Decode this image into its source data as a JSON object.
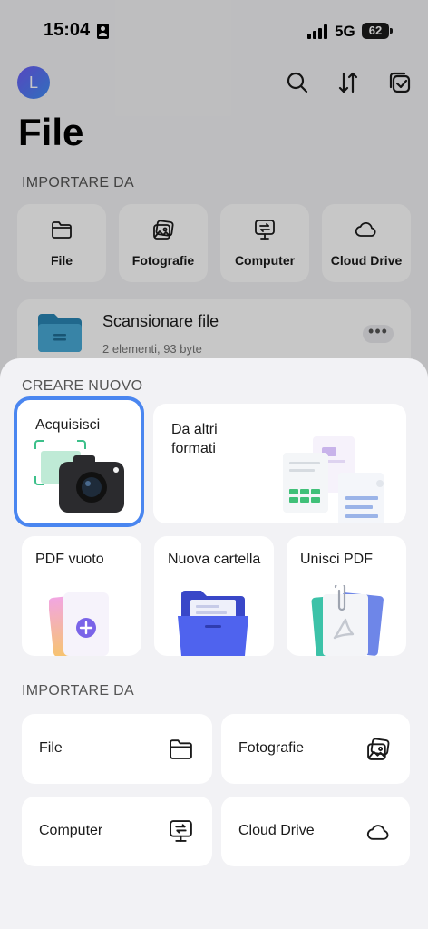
{
  "status_bar": {
    "time": "15:04",
    "network": "5G",
    "battery": "62"
  },
  "header": {
    "avatar_letter": "L",
    "title": "File"
  },
  "import_section": {
    "label": "IMPORTARE DA",
    "tiles": [
      {
        "label": "File",
        "icon": "folder-icon"
      },
      {
        "label": "Fotografie",
        "icon": "photos-icon"
      },
      {
        "label": "Computer",
        "icon": "computer-icon"
      },
      {
        "label": "Cloud Drive",
        "icon": "cloud-icon"
      }
    ]
  },
  "folder": {
    "title": "Scansionare file",
    "meta": "2 elementi, 93 byte",
    "more": "•••"
  },
  "sheet": {
    "create_label": "CREARE NUOVO",
    "create_items": [
      {
        "label": "Acquisisci",
        "icon": "camera-icon"
      },
      {
        "label": "Da altri formati",
        "icon": "documents-icon"
      },
      {
        "label": "PDF vuoto",
        "icon": "blank-pdf-icon"
      },
      {
        "label": "Nuova cartella",
        "icon": "new-folder-icon"
      },
      {
        "label": "Unisci PDF",
        "icon": "merge-pdf-icon"
      }
    ],
    "import_label": "IMPORTARE DA",
    "import_items": [
      {
        "label": "File",
        "icon": "folder-icon"
      },
      {
        "label": "Fotografie",
        "icon": "photos-icon"
      },
      {
        "label": "Computer",
        "icon": "computer-icon"
      },
      {
        "label": "Cloud Drive",
        "icon": "cloud-icon"
      }
    ]
  },
  "colors": {
    "accent": "#4a86f0",
    "sheet_bg": "#f2f2f5",
    "card_bg": "#ffffff"
  }
}
